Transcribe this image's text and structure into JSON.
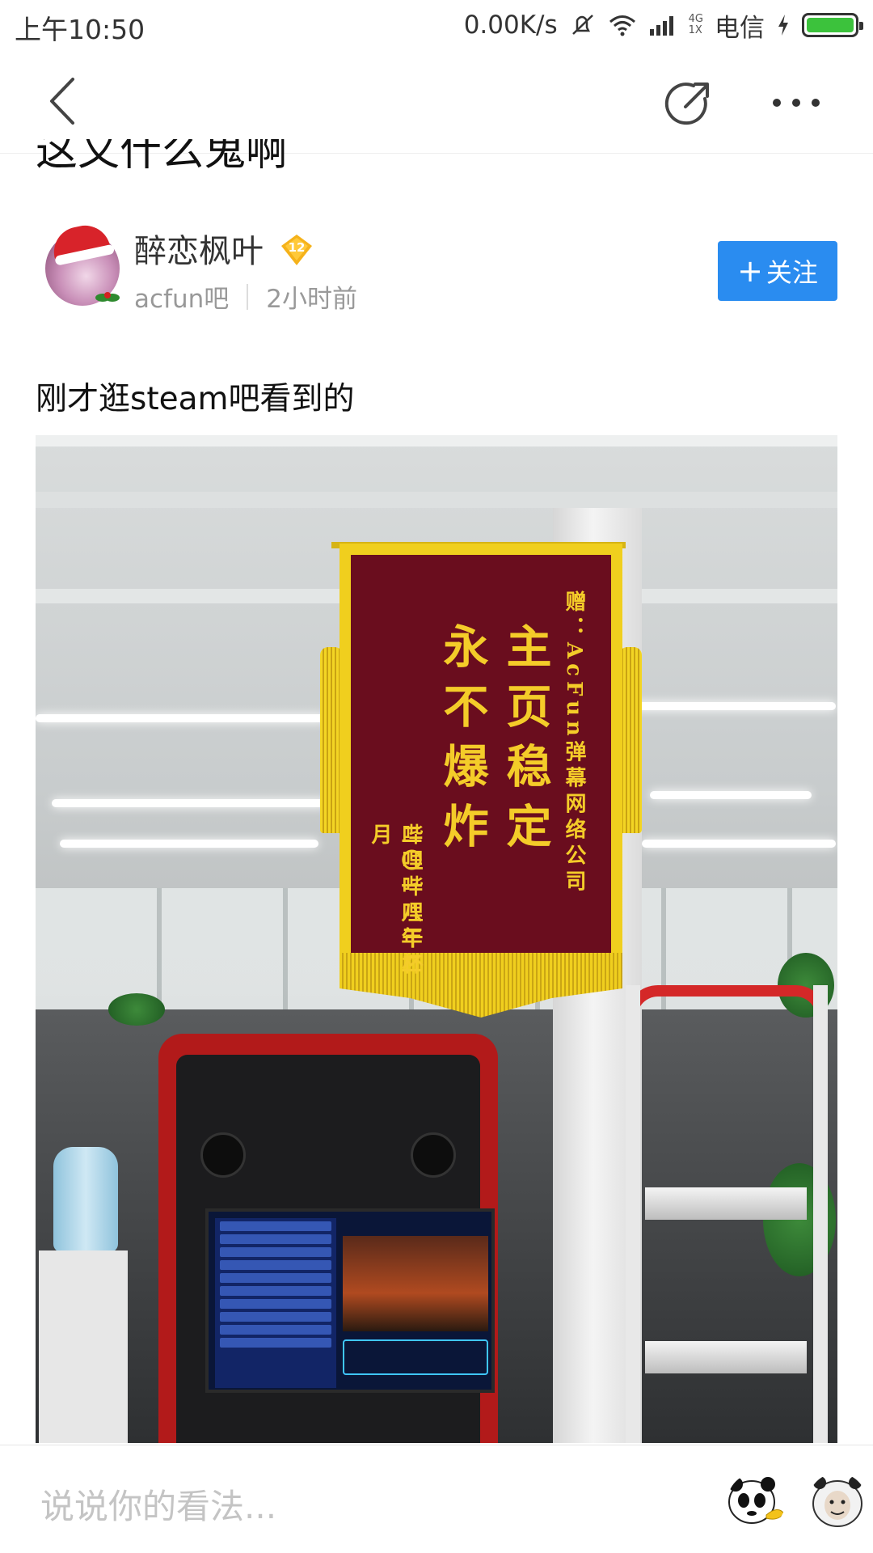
{
  "status_bar": {
    "time": "上午10:50",
    "speed": "0.00K/s",
    "network_top": "4G",
    "network_bottom": "1X",
    "carrier": "电信",
    "icons": [
      "mute-icon",
      "wifi-icon",
      "signal-icon",
      "charging-icon",
      "battery-icon"
    ],
    "battery_level": 1.0,
    "battery_color": "#3cc23c"
  },
  "nav": {
    "icons": [
      "back-icon",
      "share-icon",
      "more-icon"
    ]
  },
  "post": {
    "title": "这又什么鬼啊",
    "author": {
      "name": "醉恋枫叶",
      "level": "12",
      "forum": "acfun吧",
      "time_ago": "2小时前"
    },
    "follow_label": "关注",
    "follow_color": "#2a8cf0",
    "text": "刚才逛steam吧看到的"
  },
  "photo": {
    "banner": {
      "col_recipient": "赠：AcFun弹幕网络公司",
      "col_main_1": "主页稳定",
      "col_main_2": "永不爆炸",
      "col_sender": "哔哩哔哩干杯",
      "col_date": "二〇一八年二月"
    }
  },
  "comment_bar": {
    "placeholder": "说说你的看法...",
    "icons": [
      "panda-emoji-icon",
      "face-emoji-icon"
    ]
  }
}
